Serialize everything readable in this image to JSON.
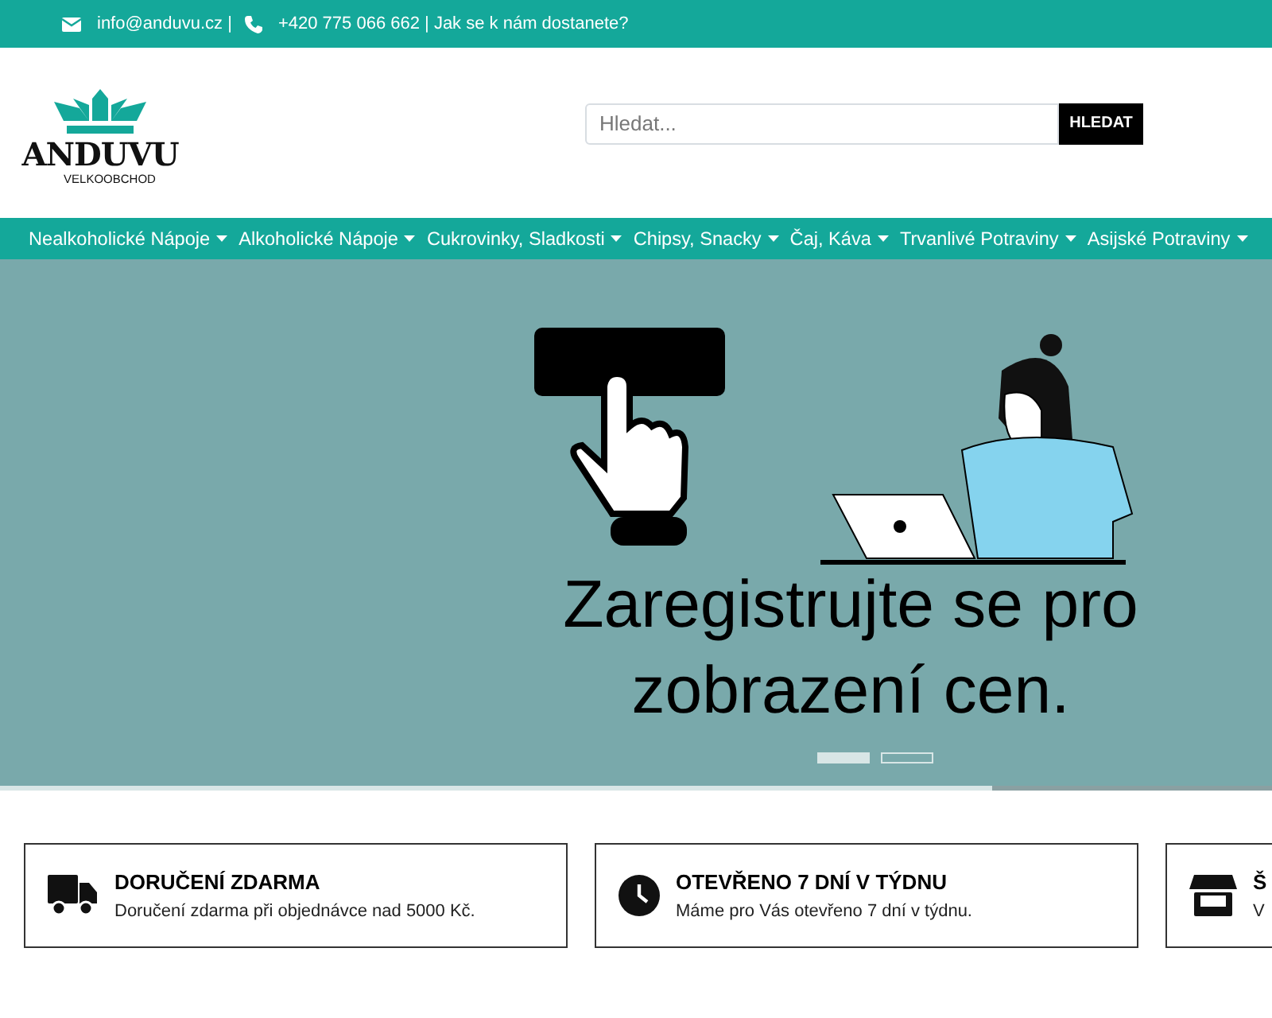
{
  "topbar": {
    "email": "info@anduvu.cz |",
    "phone": "+420 775 066 662 | Jak se k nám dostanete?"
  },
  "logo": {
    "name": "ANDUVU",
    "tagline": "VELKOOBCHOD"
  },
  "search": {
    "placeholder": "Hledat...",
    "button": "HLEDAT"
  },
  "nav": [
    {
      "label": "Nealkoholické Nápoje"
    },
    {
      "label": "Alkoholické Nápoje"
    },
    {
      "label": "Cukrovinky, Sladkosti"
    },
    {
      "label": "Chipsy, Snacky"
    },
    {
      "label": "Čaj, Káva"
    },
    {
      "label": "Trvanlivé Potraviny"
    },
    {
      "label": "Asijské Potraviny"
    }
  ],
  "banner": {
    "headline": "Zaregistrujte se pro zobrazení cen.",
    "slides": [
      {
        "selected": true
      },
      {
        "selected": false
      }
    ],
    "progress": {
      "level": 0.78
    }
  },
  "features": [
    {
      "kind": "truck",
      "title": "DORUČENÍ ZDARMA",
      "text": "Doručení zdarma při objednávce nad 5000 Kč."
    },
    {
      "kind": "clock",
      "title": "OTEVŘENO 7 DNÍ V TÝDNU",
      "text": "Máme pro Vás otevřeno 7 dní v týdnu."
    },
    {
      "kind": "store",
      "title": "Š",
      "text": "V"
    }
  ]
}
